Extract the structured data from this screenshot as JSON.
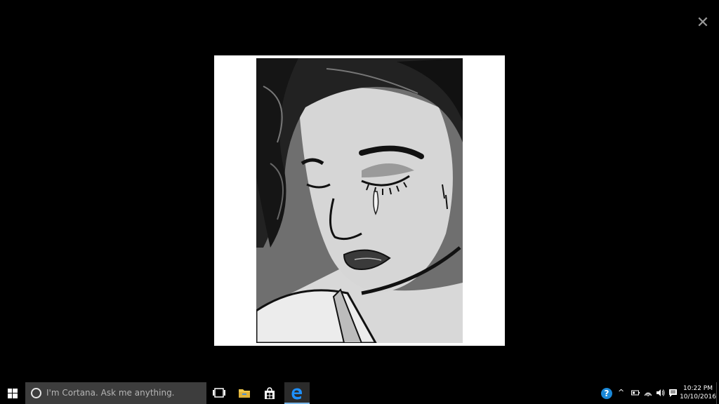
{
  "viewer": {
    "close_glyph": "✕",
    "image_description_icon": "crying-woman-illustration"
  },
  "taskbar": {
    "search_placeholder": "I'm Cortana. Ask me anything.",
    "apps": [
      "task-view-icon",
      "file-explorer-icon",
      "store-icon",
      "edge-icon"
    ],
    "help_glyph": "?",
    "chevron_glyph": "^",
    "clock_time": "10:22 PM",
    "clock_date": "10/10/2016",
    "accent": "#7bb7e8"
  }
}
